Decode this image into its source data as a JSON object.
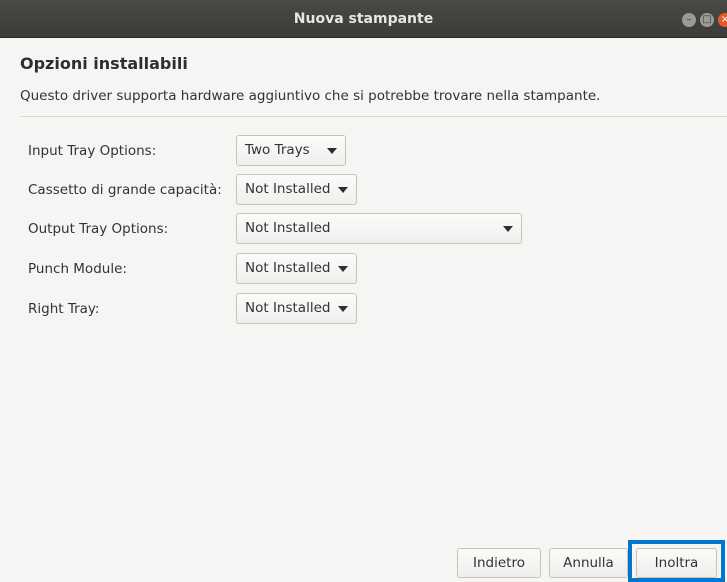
{
  "window": {
    "title": "Nuova stampante"
  },
  "header": {
    "title": "Opzioni installabili",
    "description": "Questo driver supporta hardware aggiuntivo che si potrebbe trovare nella stampante."
  },
  "options": [
    {
      "label": "Input Tray Options:",
      "value": "Two Trays"
    },
    {
      "label": "Cassetto di grande capacità:",
      "value": "Not Installed"
    },
    {
      "label": "Output Tray Options:",
      "value": "Not Installed"
    },
    {
      "label": "Punch Module:",
      "value": "Not Installed"
    },
    {
      "label": "Right Tray:",
      "value": "Not Installed"
    }
  ],
  "buttons": {
    "back": "Indietro",
    "cancel": "Annulla",
    "forward": "Inoltra"
  },
  "colors": {
    "highlight": "#0077cc",
    "close_button": "#e35b2a"
  }
}
